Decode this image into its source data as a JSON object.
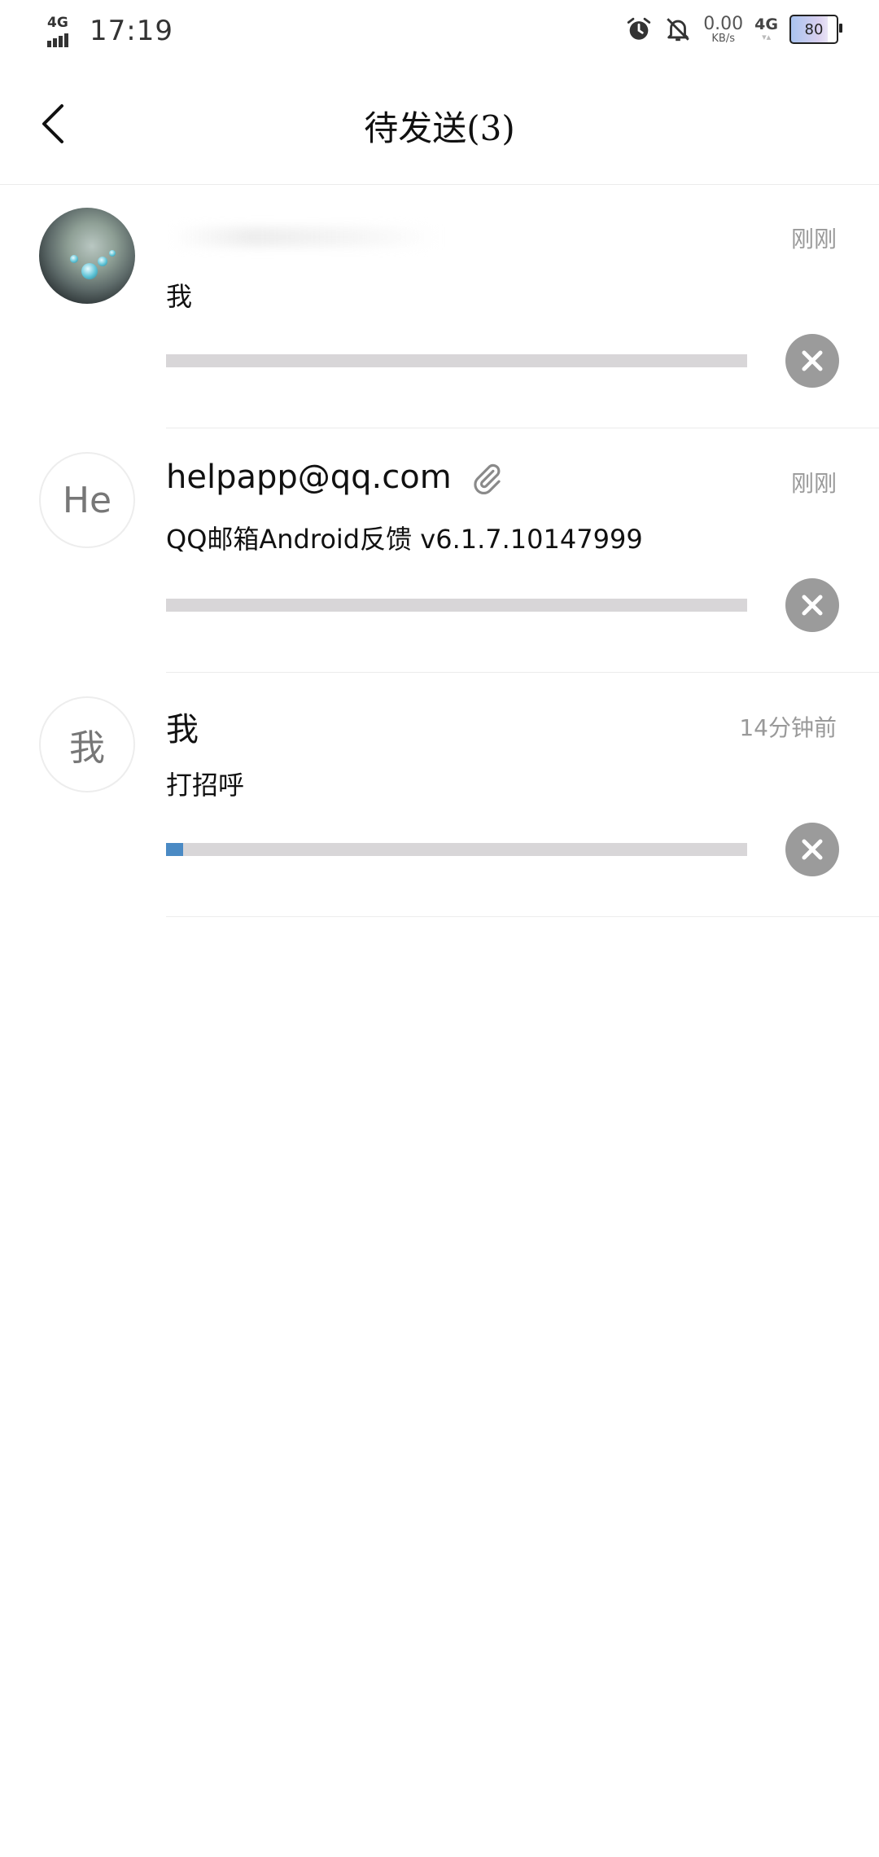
{
  "status_bar": {
    "network_type": "4G",
    "time": "17:19",
    "speed_value": "0.00",
    "speed_unit": "KB/s",
    "network_right": "4G",
    "battery": "80"
  },
  "nav": {
    "title": "待发送(3)"
  },
  "outbox": [
    {
      "sender": "",
      "subject": "我",
      "time": "刚刚",
      "progress": 0,
      "has_attachment": false
    },
    {
      "sender": "helpapp@qq.com",
      "avatar_text": "He",
      "subject": "QQ邮箱Android反馈 v6.1.7.10147999",
      "time": "刚刚",
      "progress": 0,
      "has_attachment": true
    },
    {
      "sender": "我",
      "avatar_text": "我",
      "subject": "打招呼",
      "time": "14分钟前",
      "progress": 0.03,
      "has_attachment": false
    }
  ],
  "colors": {
    "progress_fill": "#4a8ac4",
    "progress_track": "#d8d6d8",
    "cancel_button": "#9b9b9b"
  }
}
